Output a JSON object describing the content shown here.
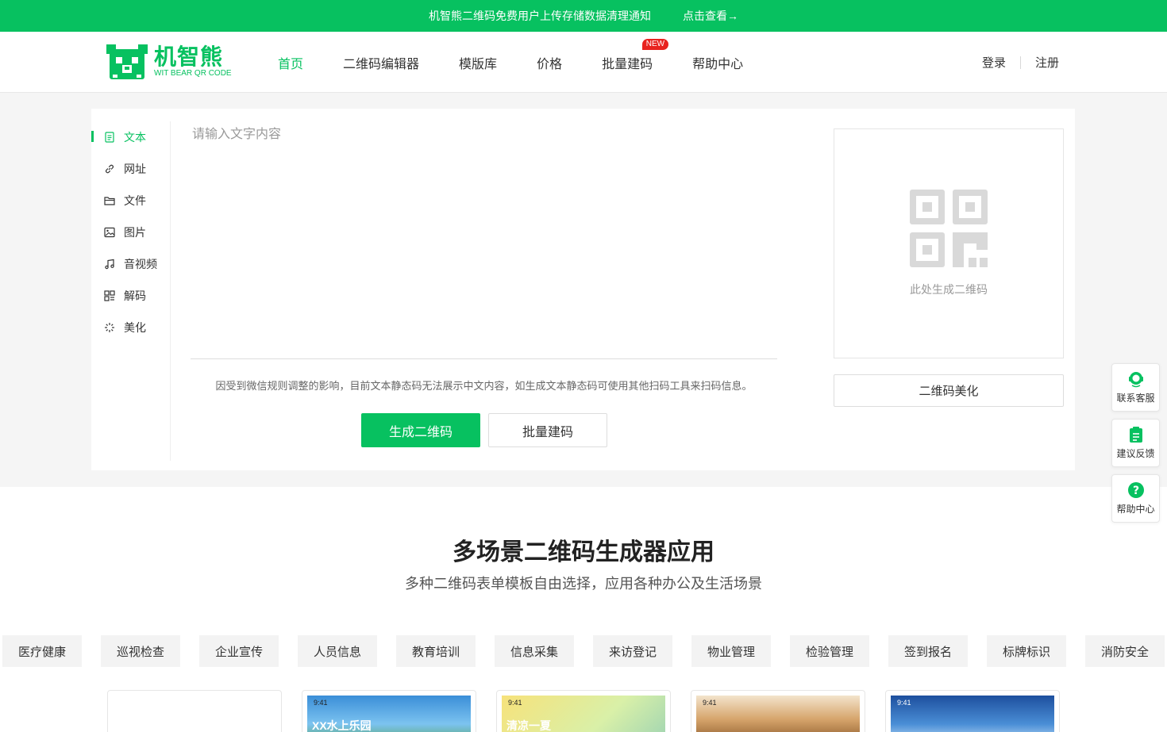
{
  "announcement": {
    "text": "机智熊二维码免费用户上传存储数据清理通知",
    "link": "点击查看→"
  },
  "brand": {
    "name_cn": "机智熊",
    "name_en": "WIT BEAR QR CODE",
    "color": "#07c160"
  },
  "nav": {
    "items": [
      {
        "label": "首页",
        "active": true
      },
      {
        "label": "二维码编辑器",
        "active": false
      },
      {
        "label": "模版库",
        "active": false
      },
      {
        "label": "价格",
        "active": false
      },
      {
        "label": "批量建码",
        "active": false,
        "badge": "NEW"
      },
      {
        "label": "帮助中心",
        "active": false
      }
    ]
  },
  "auth": {
    "login": "登录",
    "register": "注册"
  },
  "sidebar": {
    "items": [
      {
        "label": "文本",
        "icon": "document-icon",
        "active": true
      },
      {
        "label": "网址",
        "icon": "link-icon",
        "active": false
      },
      {
        "label": "文件",
        "icon": "folder-icon",
        "active": false
      },
      {
        "label": "图片",
        "icon": "image-icon",
        "active": false
      },
      {
        "label": "音视频",
        "icon": "music-icon",
        "active": false
      },
      {
        "label": "解码",
        "icon": "scan-icon",
        "active": false
      },
      {
        "label": "美化",
        "icon": "sparkle-icon",
        "active": false
      }
    ]
  },
  "editor": {
    "placeholder": "请输入文字内容",
    "value": "",
    "tip": "因受到微信规则调整的影响，目前文本静态码无法展示中文内容，如生成文本静态码可使用其他扫码工具来扫码信息。",
    "generate_label": "生成二维码",
    "batch_label": "批量建码"
  },
  "preview": {
    "placeholder": "此处生成二维码",
    "beautify_label": "二维码美化"
  },
  "float_tools": [
    {
      "label": "联系客服",
      "icon": "headset-icon"
    },
    {
      "label": "建议反馈",
      "icon": "clipboard-icon"
    },
    {
      "label": "帮助中心",
      "icon": "help-icon"
    }
  ],
  "section": {
    "title": "多场景二维码生成器应用",
    "subtitle": "多种二维码表单模板自由选择，应用各种办公及生活场景"
  },
  "tags": [
    "医疗健康",
    "巡视检查",
    "企业宣传",
    "人员信息",
    "教育培训",
    "信息采集",
    "来访登记",
    "物业管理",
    "检验管理",
    "签到报名",
    "标牌标识",
    "消防安全"
  ],
  "cards": [
    {
      "time": "",
      "caption": ""
    },
    {
      "time": "9:41",
      "caption": "XX水上乐园"
    },
    {
      "time": "9:41",
      "caption": "清凉一夏"
    },
    {
      "time": "9:41",
      "caption": ""
    },
    {
      "time": "9:41",
      "caption": ""
    }
  ]
}
